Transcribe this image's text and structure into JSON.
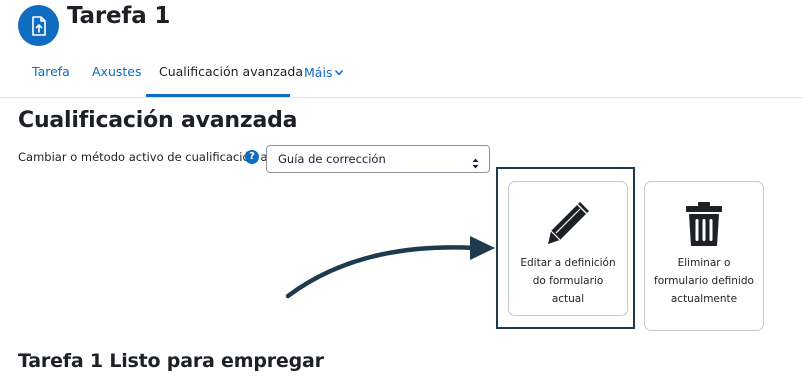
{
  "header": {
    "title": "Tarefa 1",
    "icon": "assignment-icon",
    "icon_color": "#0f6cbf"
  },
  "nav": {
    "tabs": [
      {
        "label": "Tarefa",
        "active": false
      },
      {
        "label": "Axustes",
        "active": false
      },
      {
        "label": "Cualificación avanzada",
        "active": true
      },
      {
        "label": "Máis",
        "active": false,
        "has_dropdown": true
      }
    ]
  },
  "main": {
    "heading": "Cualificación avanzada",
    "method_label": "Cambiar o método activo de cualificación a",
    "help_icon": "?",
    "method_select": {
      "value": "Guía de corrección"
    },
    "actions": [
      {
        "label": "Editar a definición do formulario actual",
        "icon": "pencil-icon"
      },
      {
        "label": "Eliminar o formulario definido actualmente",
        "icon": "trash-icon"
      }
    ],
    "status_heading": "Tarefa 1 Listo para empregar"
  },
  "colors": {
    "accent": "#0f6cbf",
    "text": "#1d2125",
    "highlight_frame": "#1f3a4d"
  }
}
